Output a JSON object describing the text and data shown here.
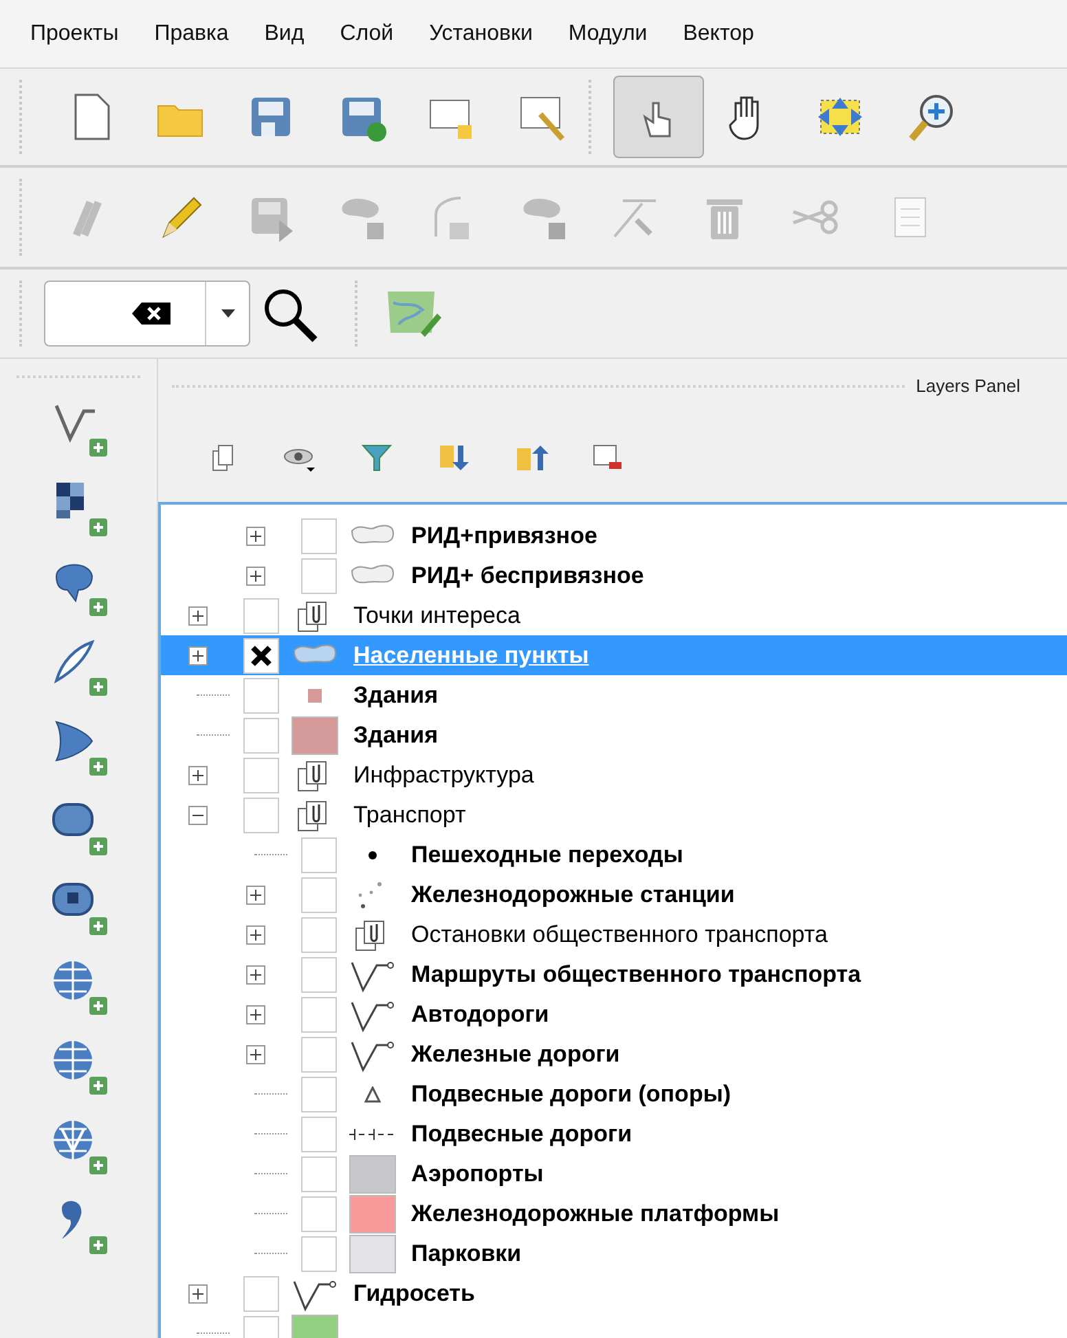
{
  "menu": [
    {
      "label": "Проекты"
    },
    {
      "label": "Правка"
    },
    {
      "label": "Вид"
    },
    {
      "label": "Слой"
    },
    {
      "label": "Установки"
    },
    {
      "label": "Модули"
    },
    {
      "label": "Вектор"
    }
  ],
  "main_toolbar": [
    {
      "selected": false
    },
    {
      "selected": false
    },
    {
      "selected": false
    },
    {
      "selected": false
    },
    {
      "selected": false
    },
    {
      "selected": false
    },
    {
      "selected": true
    },
    {
      "selected": false
    },
    {
      "selected": false
    },
    {
      "selected": false
    }
  ],
  "edit_toolbar": [
    {
      "disabled": true
    },
    {
      "disabled": false
    },
    {
      "disabled": true
    },
    {
      "disabled": true
    },
    {
      "disabled": true
    },
    {
      "disabled": true
    },
    {
      "disabled": true
    },
    {
      "disabled": true
    },
    {
      "disabled": true
    },
    {
      "disabled": true
    }
  ],
  "layers_panel": {
    "title": "Layers Panel",
    "tree": [
      {
        "children": [
          {
            "name": "РИД+привязное",
            "kind": "polygon",
            "checked": false,
            "expanded": false,
            "selected": false
          },
          {
            "name": "РИД+ беспривязное",
            "kind": "polygon",
            "checked": false,
            "expanded": false,
            "selected": false
          }
        ]
      },
      {
        "name": "Точки интереса",
        "kind": "group",
        "checked": false,
        "expanded": false,
        "selected": false
      },
      {
        "name": "Населенные пункты",
        "kind": "polygon",
        "checked": true,
        "expanded": false,
        "selected": true
      },
      {
        "name": "Здания",
        "kind": "point",
        "checked": false,
        "selected": false,
        "color": "#d49a9a"
      },
      {
        "name": "Здания",
        "kind": "fill",
        "checked": false,
        "selected": false,
        "color": "#d49a9a"
      },
      {
        "name": "Инфраструктура",
        "kind": "group",
        "checked": false,
        "expanded": false,
        "selected": false
      },
      {
        "name": "Транспорт",
        "kind": "group",
        "checked": false,
        "expanded": true,
        "selected": false,
        "children": [
          {
            "name": "Пешеходные переходы",
            "kind": "dot",
            "checked": false,
            "selected": false
          },
          {
            "name": "Железнодорожные станции",
            "kind": "stations",
            "checked": false,
            "expanded": false,
            "selected": false
          },
          {
            "name": "Остановки общественного транспорта",
            "kind": "group",
            "checked": false,
            "expanded": false,
            "selected": false
          },
          {
            "name": "Маршруты общественного транспорта",
            "kind": "line",
            "checked": false,
            "expanded": false,
            "selected": false
          },
          {
            "name": "Автодороги",
            "kind": "line",
            "checked": false,
            "expanded": false,
            "selected": false
          },
          {
            "name": "Железные дороги",
            "kind": "line",
            "checked": false,
            "expanded": false,
            "selected": false
          },
          {
            "name": "Подвесные дороги (опоры)",
            "kind": "triangle",
            "checked": false,
            "selected": false
          },
          {
            "name": "Подвесные дороги",
            "kind": "dashed",
            "checked": false,
            "selected": false
          },
          {
            "name": "Аэропорты",
            "kind": "fill",
            "checked": false,
            "selected": false,
            "color": "#c8c8cc"
          },
          {
            "name": "Железнодорожные платформы",
            "kind": "fill",
            "checked": false,
            "selected": false,
            "color": "#f99a9a"
          },
          {
            "name": "Парковки",
            "kind": "fill",
            "checked": false,
            "selected": false,
            "color": "#e4e4e8"
          }
        ]
      },
      {
        "name": "Гидросеть",
        "kind": "line",
        "checked": false,
        "expanded": false,
        "selected": false
      },
      {
        "kind": "fill",
        "checked": false,
        "selected": false,
        "color": "#90d080"
      }
    ]
  }
}
